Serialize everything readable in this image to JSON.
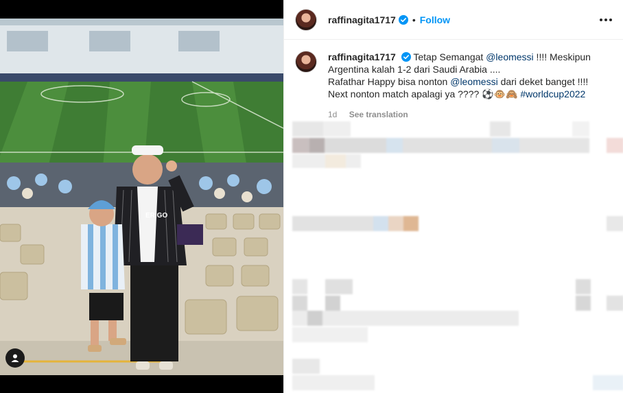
{
  "post": {
    "username": "raffinagita1717",
    "follow_label": "Follow",
    "dot": "•",
    "caption": {
      "part1": "Tetap Semangat ",
      "mention1": "@leomessi",
      "part2": " !!!! Meskipun Argentina kalah 1-2 dari Saudi Arabia ....",
      "part3": "Rafathar Happy bisa nonton ",
      "mention2": "@leomessi",
      "part4": " dari deket banget !!!!",
      "part5": "Next nonton match apalagi ya ???? ⚽🐵🙈 ",
      "hashtag": "#worldcup2022"
    },
    "time": "1d",
    "see_translation": "See translation"
  },
  "photo": {
    "shirt_text": "ERIGO"
  },
  "colors": {
    "link_blue": "#0095f6",
    "mention": "#00376b",
    "muted": "#8e8e8e",
    "text": "#262626"
  },
  "icons": [
    "verified-badge-icon",
    "more-options-icon",
    "user-tag-icon"
  ]
}
